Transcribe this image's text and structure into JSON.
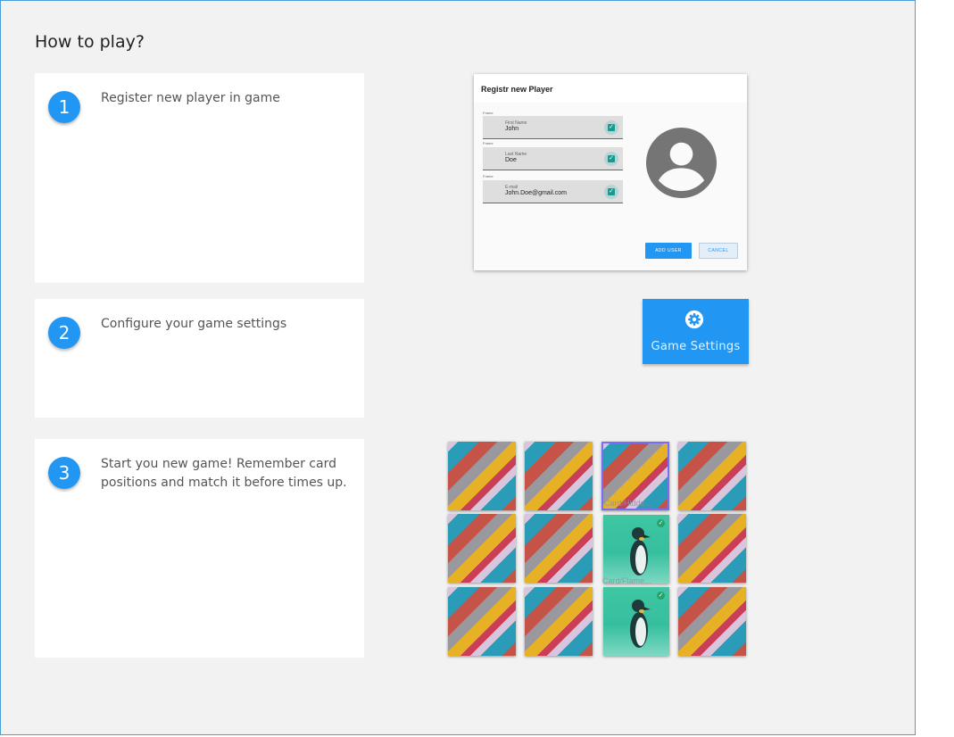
{
  "page": {
    "title": "How to play?"
  },
  "steps": [
    {
      "number": "1",
      "text": "Register new player in game"
    },
    {
      "number": "2",
      "text": "Configure your game settings"
    },
    {
      "number": "3",
      "text": "Start you new game! Remember card positions and match it before times up."
    }
  ],
  "register_dialog": {
    "title": "Registr new Player",
    "fields": [
      {
        "caption": "Frame",
        "label": "First Name",
        "value": "John"
      },
      {
        "caption": "Frame",
        "label": "Last Name",
        "value": "Doe"
      },
      {
        "caption": "Frame",
        "label": "E-mail",
        "value": "John.Doe@gmail.com"
      }
    ],
    "add_label": "ADD USER",
    "cancel_label": "CANCEL",
    "avatar_icon": "account-circle-icon"
  },
  "settings_button": {
    "label": "Game Settings",
    "icon": "gear-icon"
  },
  "cards": {
    "card_name_1": "Card/Hidde...",
    "card_name_2": "Card/Flame...",
    "grid": [
      [
        "hidden",
        "hidden",
        "selected",
        "hidden"
      ],
      [
        "hidden",
        "hidden",
        "matched",
        "hidden"
      ],
      [
        "hidden",
        "hidden",
        "matched",
        "hidden"
      ]
    ]
  },
  "colors": {
    "accent": "#2196f3",
    "background": "#f2f2f2",
    "check": "#159b8f"
  }
}
